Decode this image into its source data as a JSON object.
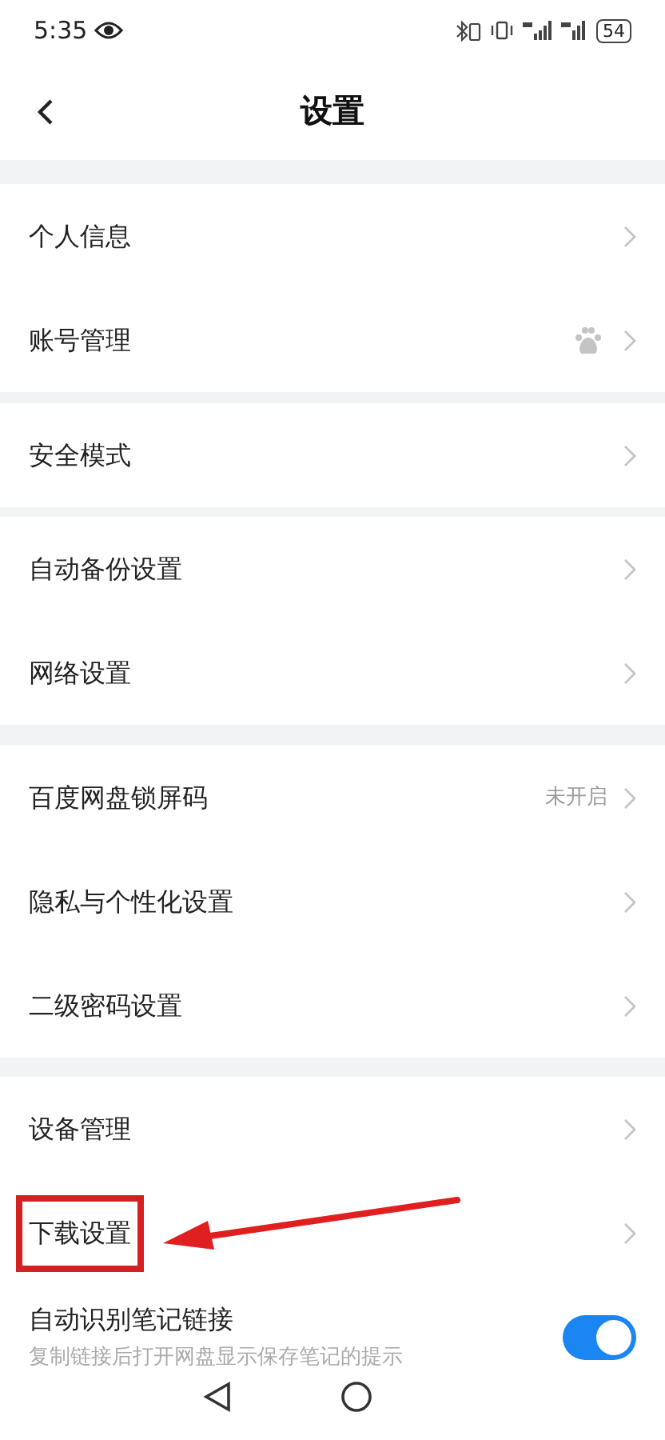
{
  "status_bar": {
    "time": "5:35",
    "battery": "54"
  },
  "header": {
    "title": "设置"
  },
  "groups": [
    {
      "rows": [
        {
          "kind": "link",
          "label": "个人信息"
        },
        {
          "kind": "link",
          "label": "账号管理",
          "badge_icon": true
        }
      ]
    },
    {
      "rows": [
        {
          "kind": "link",
          "label": "安全模式"
        }
      ]
    },
    {
      "rows": [
        {
          "kind": "link",
          "label": "自动备份设置"
        },
        {
          "kind": "link",
          "label": "网络设置"
        }
      ]
    },
    {
      "rows": [
        {
          "kind": "link",
          "label": "百度网盘锁屏码",
          "value": "未开启"
        },
        {
          "kind": "link",
          "label": "隐私与个性化设置"
        },
        {
          "kind": "link",
          "label": "二级密码设置"
        }
      ]
    },
    {
      "rows": [
        {
          "kind": "link",
          "label": "设备管理"
        },
        {
          "kind": "link",
          "label": "下载设置",
          "highlighted": true
        },
        {
          "kind": "toggle",
          "label": "自动识别笔记链接",
          "description": "复制链接后打开网盘显示保存笔记的提示",
          "on": true
        }
      ]
    }
  ]
}
